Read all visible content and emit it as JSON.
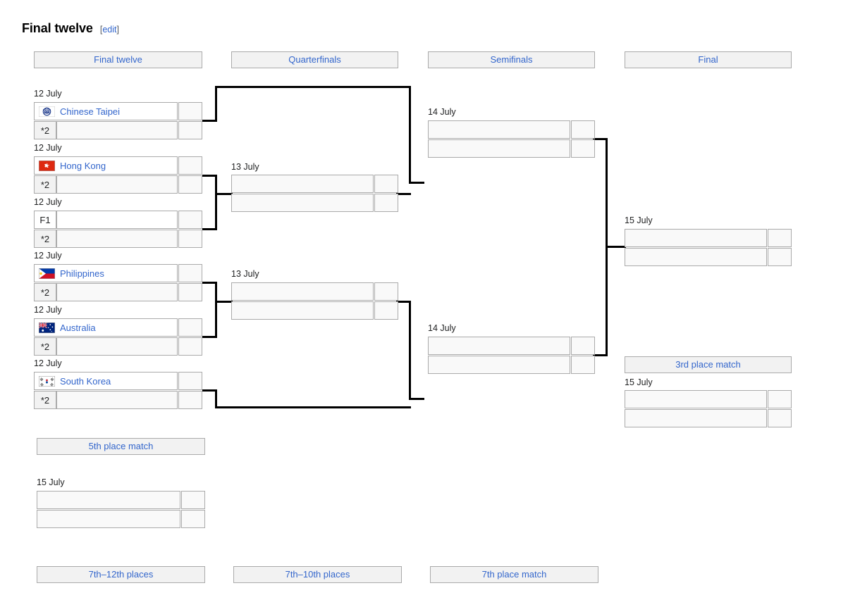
{
  "heading": {
    "title": "Final twelve",
    "edit_open": "[",
    "edit_label": "edit",
    "edit_close": "]"
  },
  "round_headers": [
    {
      "label": "Final twelve"
    },
    {
      "label": "Quarterfinals"
    },
    {
      "label": "Semifinals"
    },
    {
      "label": "Final"
    }
  ],
  "placement_headers": [
    {
      "label": "3rd place match"
    },
    {
      "label": "5th place match"
    },
    {
      "label": "7th–12th places"
    },
    {
      "label": "7th–10th places"
    },
    {
      "label": "7th place match"
    }
  ],
  "final_twelve": [
    {
      "date": "12 July",
      "top": {
        "flag": "chinese-taipei-flag",
        "team": "Chinese Taipei",
        "score": ""
      },
      "bottom": {
        "seed": "*2",
        "team": "",
        "score": ""
      }
    },
    {
      "date": "12 July",
      "top": {
        "flag": "hong-kong-flag",
        "team": "Hong Kong",
        "score": ""
      },
      "bottom": {
        "seed": "*2",
        "team": "",
        "score": ""
      }
    },
    {
      "date": "12 July",
      "top": {
        "seed": "F1",
        "team": "",
        "score": ""
      },
      "bottom": {
        "seed": "*2",
        "team": "",
        "score": ""
      }
    },
    {
      "date": "12 July",
      "top": {
        "flag": "philippines-flag",
        "team": "Philippines",
        "score": ""
      },
      "bottom": {
        "seed": "*2",
        "team": "",
        "score": ""
      }
    },
    {
      "date": "12 July",
      "top": {
        "flag": "australia-flag",
        "team": "Australia",
        "score": ""
      },
      "bottom": {
        "seed": "*2",
        "team": "",
        "score": ""
      }
    },
    {
      "date": "12 July",
      "top": {
        "flag": "south-korea-flag",
        "team": "South Korea",
        "score": ""
      },
      "bottom": {
        "seed": "*2",
        "team": "",
        "score": ""
      }
    }
  ],
  "quarterfinals": [
    {
      "date": "13 July",
      "top": {
        "team": "",
        "score": ""
      },
      "bottom": {
        "team": "",
        "score": ""
      }
    },
    {
      "date": "13 July",
      "top": {
        "team": "",
        "score": ""
      },
      "bottom": {
        "team": "",
        "score": ""
      }
    }
  ],
  "semifinals": [
    {
      "date": "14 July",
      "top": {
        "team": "",
        "score": ""
      },
      "bottom": {
        "team": "",
        "score": ""
      }
    },
    {
      "date": "14 July",
      "top": {
        "team": "",
        "score": ""
      },
      "bottom": {
        "team": "",
        "score": ""
      }
    }
  ],
  "final": {
    "date": "15 July",
    "top": {
      "team": "",
      "score": ""
    },
    "bottom": {
      "team": "",
      "score": ""
    }
  },
  "third_place": {
    "date": "15 July",
    "top": {
      "team": "",
      "score": ""
    },
    "bottom": {
      "team": "",
      "score": ""
    }
  },
  "fifth_place": {
    "date": "15 July",
    "top": {
      "team": "",
      "score": ""
    },
    "bottom": {
      "team": "",
      "score": ""
    }
  },
  "colors": {
    "link": "#3366cc",
    "box_border": "#aaaaaa",
    "box_fill": "#f9f9f9",
    "header_fill": "#f2f2f2",
    "connector": "#000000"
  }
}
